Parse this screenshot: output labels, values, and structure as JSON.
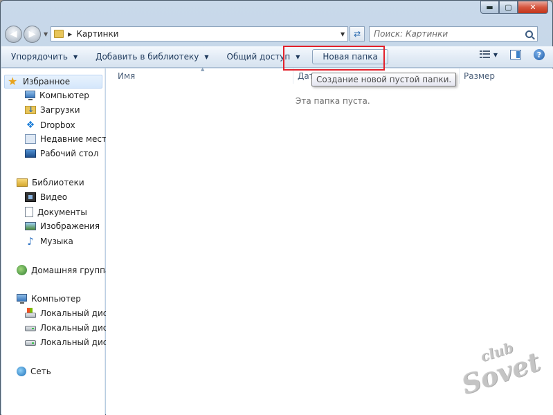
{
  "window": {
    "controls": {
      "minimize": "▬",
      "maximize": "▢",
      "close": "✕"
    }
  },
  "address": {
    "path": "Картинки",
    "search_placeholder": "Поиск: Картинки"
  },
  "toolbar": {
    "organize": "Упорядочить",
    "add_to_library": "Добавить в библиотеку",
    "share": "Общий доступ",
    "new_folder": "Новая папка",
    "help": "?"
  },
  "sidebar": {
    "favorites": {
      "label": "Избранное",
      "items": [
        "Компьютер",
        "Загрузки",
        "Dropbox",
        "Недавние места",
        "Рабочий стол"
      ]
    },
    "libraries": {
      "label": "Библиотеки",
      "items": [
        "Видео",
        "Документы",
        "Изображения",
        "Музыка"
      ]
    },
    "homegroup": "Домашняя группа",
    "computer": {
      "label": "Компьютер",
      "items": [
        "Локальный диск",
        "Локальный диск",
        "Локальный диск"
      ]
    },
    "network": "Сеть"
  },
  "content": {
    "columns": {
      "name": "Имя",
      "date": "Дат",
      "size": "Размер"
    },
    "empty_message": "Эта папка пуста.",
    "tooltip": "Создание новой пустой папки."
  },
  "watermark": {
    "top": "club",
    "bottom": "Sovet"
  }
}
